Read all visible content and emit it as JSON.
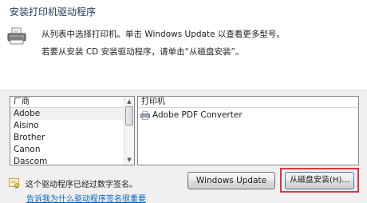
{
  "dialog": {
    "title": "安装打印机驱动程序",
    "instruction_1": "从列表中选择打印机。单击 Windows Update 以查看更多型号。",
    "instruction_2": "若要从安装 CD 安装驱动程序，请单击“从磁盘安装”。"
  },
  "manufacturer_list": {
    "header": "厂商",
    "items": [
      "Adobe",
      "Aisino",
      "Brother",
      "Canon",
      "Dascom"
    ],
    "selected": "Adobe"
  },
  "printer_list": {
    "header": "打印机",
    "items": [
      "Adobe PDF Converter"
    ]
  },
  "signature": {
    "status_text": "这个驱动程序已经过数字签名。",
    "link_text": "告诉我为什么驱动程序签名很重要"
  },
  "buttons": {
    "windows_update": "Windows Update",
    "have_disk": "从磁盘安装(H)..."
  },
  "colors": {
    "highlight": "#e23535",
    "link": "#0066cc",
    "title": "#1e395b"
  }
}
